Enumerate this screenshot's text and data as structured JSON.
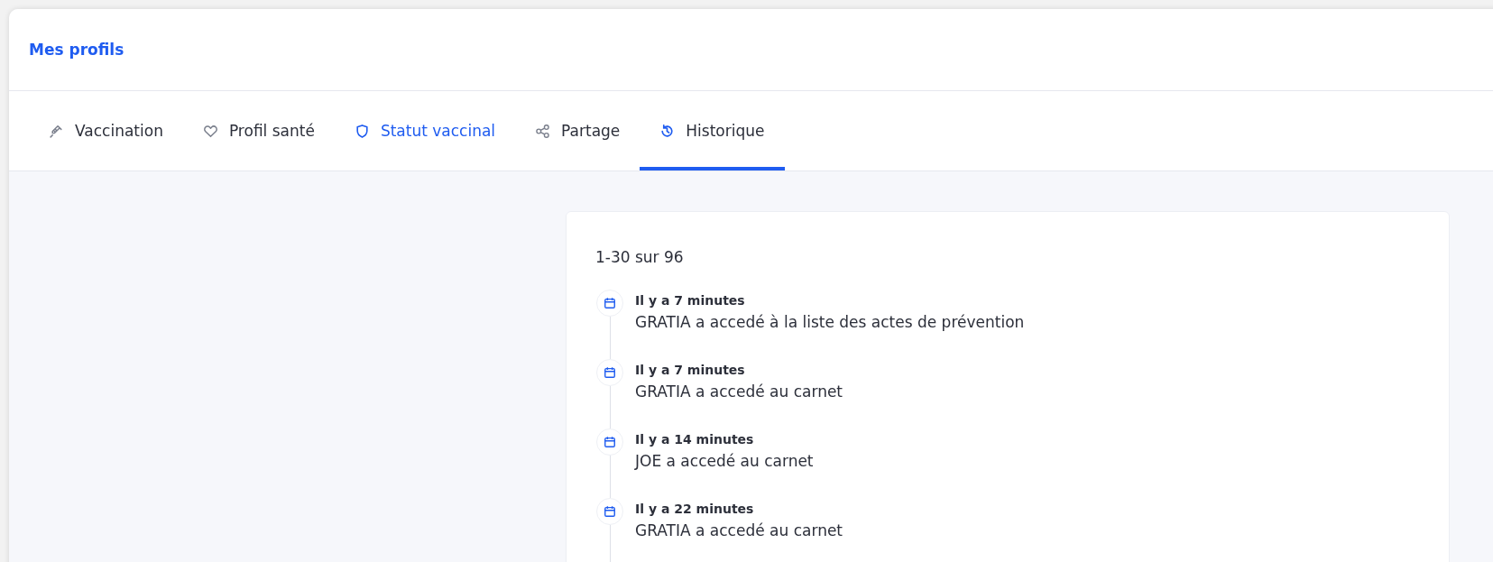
{
  "page_title": "Mes profils",
  "tabs": [
    {
      "label": "Vaccination",
      "kind": "syringe",
      "selected": false,
      "highlighted": false
    },
    {
      "label": "Profil santé",
      "kind": "heart",
      "selected": false,
      "highlighted": false
    },
    {
      "label": "Statut vaccinal",
      "kind": "shield",
      "selected": false,
      "highlighted": true
    },
    {
      "label": "Partage",
      "kind": "share",
      "selected": false,
      "highlighted": false
    },
    {
      "label": "Historique",
      "kind": "history",
      "selected": true,
      "highlighted": false
    }
  ],
  "history": {
    "count": "1-30 sur 96",
    "events": [
      {
        "time": "Il y a 7 minutes",
        "message": "GRATIA a accedé à la liste des actes de prévention"
      },
      {
        "time": "Il y a 7 minutes",
        "message": "GRATIA a accedé au carnet"
      },
      {
        "time": "Il y a 14 minutes",
        "message": "JOE a accedé au carnet"
      },
      {
        "time": "Il y a 22 minutes",
        "message": "GRATIA a accedé au carnet"
      }
    ]
  }
}
